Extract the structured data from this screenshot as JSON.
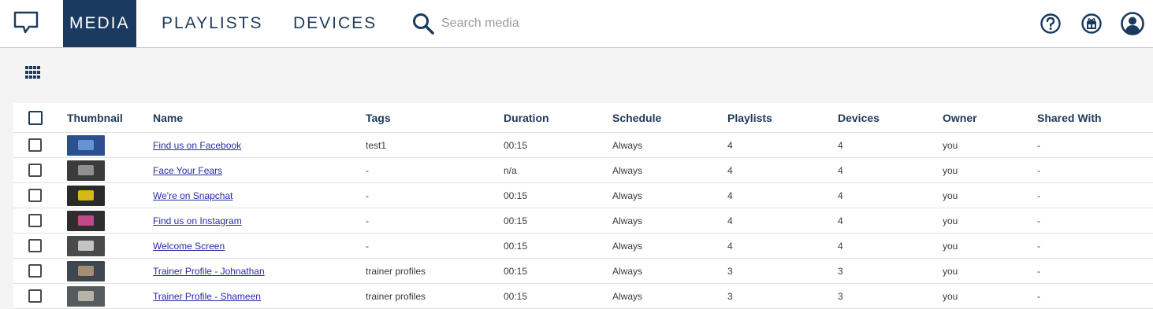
{
  "nav": {
    "tabs": [
      {
        "label": "MEDIA",
        "active": true
      },
      {
        "label": "PLAYLISTS",
        "active": false
      },
      {
        "label": "DEVICES",
        "active": false
      }
    ],
    "search": {
      "placeholder": "Search media",
      "value": ""
    }
  },
  "colors": {
    "brand": "#1a3a5f",
    "link": "#2a2aa8"
  },
  "icons": {
    "logo": "chat-bubble-icon",
    "search": "search-icon",
    "help": "help-icon",
    "gift": "gift-icon",
    "account": "account-icon",
    "view_toggle": "grid-view-icon"
  },
  "table": {
    "columns": [
      "Thumbnail",
      "Name",
      "Tags",
      "Duration",
      "Schedule",
      "Playlists",
      "Devices",
      "Owner",
      "Shared With"
    ],
    "rows": [
      {
        "name": "Find us on Facebook",
        "tags": "test1",
        "duration": "00:15",
        "schedule": "Always",
        "playlists": "4",
        "devices": "4",
        "owner": "you",
        "shared": "-",
        "thumb_bg": "#2b4f8f",
        "thumb_accent": "#6fa0e0"
      },
      {
        "name": "Face Your Fears",
        "tags": "-",
        "duration": "n/a",
        "schedule": "Always",
        "playlists": "4",
        "devices": "4",
        "owner": "you",
        "shared": "-",
        "thumb_bg": "#3b3b3b",
        "thumb_accent": "#a0a0a0"
      },
      {
        "name": "We're on Snapchat",
        "tags": "-",
        "duration": "00:15",
        "schedule": "Always",
        "playlists": "4",
        "devices": "4",
        "owner": "you",
        "shared": "-",
        "thumb_bg": "#2a2a2a",
        "thumb_accent": "#f2d40f"
      },
      {
        "name": "Find us on Instagram",
        "tags": "-",
        "duration": "00:15",
        "schedule": "Always",
        "playlists": "4",
        "devices": "4",
        "owner": "you",
        "shared": "-",
        "thumb_bg": "#2e2e2e",
        "thumb_accent": "#d84f9a"
      },
      {
        "name": "Welcome Screen",
        "tags": "-",
        "duration": "00:15",
        "schedule": "Always",
        "playlists": "4",
        "devices": "4",
        "owner": "you",
        "shared": "-",
        "thumb_bg": "#4a4a4a",
        "thumb_accent": "#d8d8d8"
      },
      {
        "name": "Trainer Profile - Johnathan",
        "tags": "trainer profiles",
        "duration": "00:15",
        "schedule": "Always",
        "playlists": "3",
        "devices": "3",
        "owner": "you",
        "shared": "-",
        "thumb_bg": "#3e4650",
        "thumb_accent": "#b89a7a"
      },
      {
        "name": "Trainer Profile - Shameen",
        "tags": "trainer profiles",
        "duration": "00:15",
        "schedule": "Always",
        "playlists": "3",
        "devices": "3",
        "owner": "you",
        "shared": "-",
        "thumb_bg": "#565b5e",
        "thumb_accent": "#c9c3b6"
      }
    ]
  }
}
